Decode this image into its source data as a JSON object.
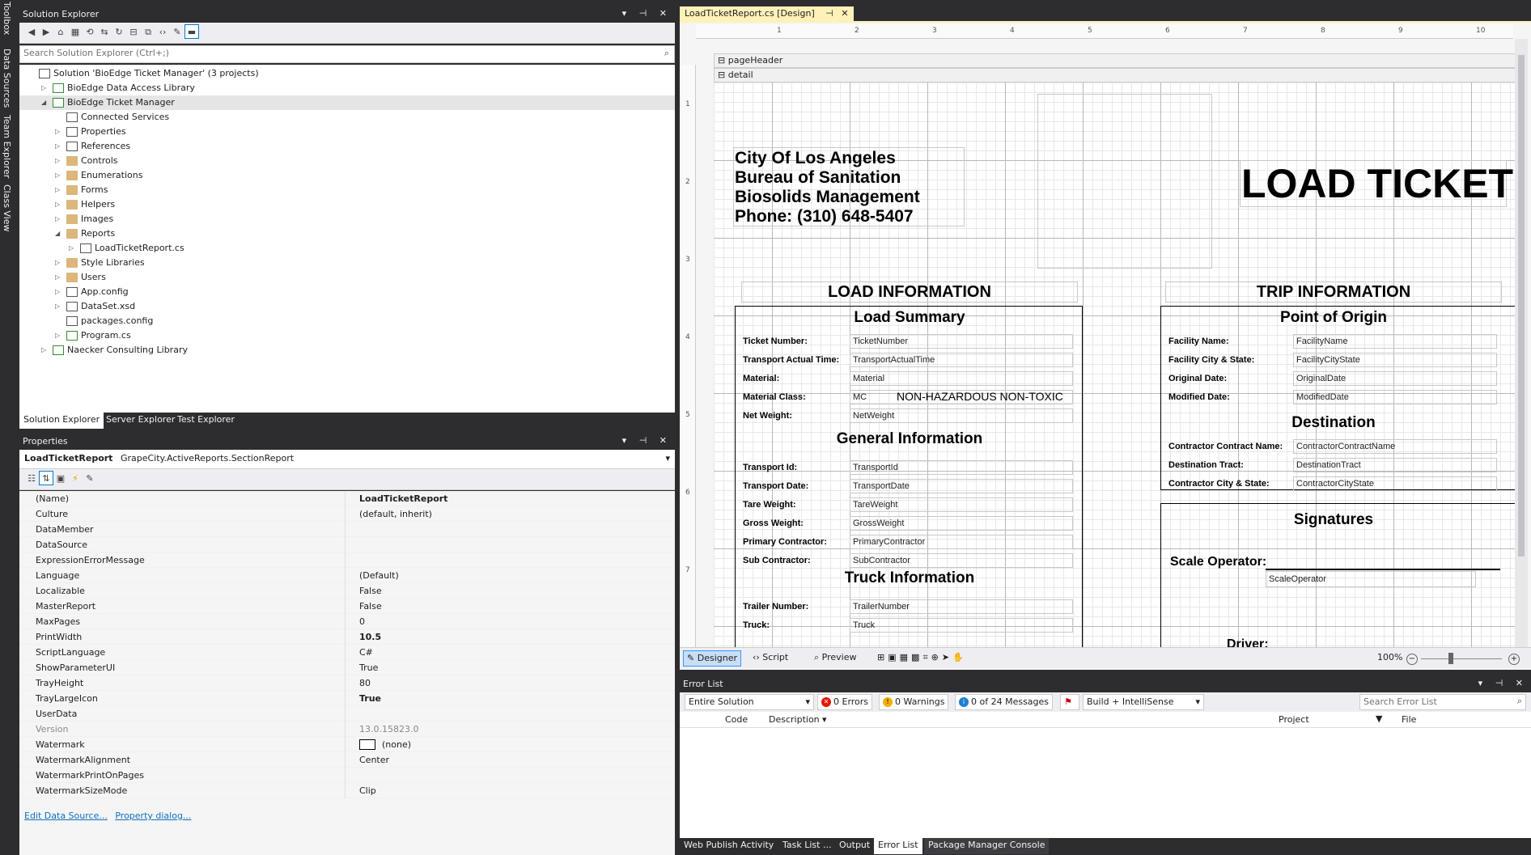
{
  "left_strip": {
    "tabs": [
      "Toolbox",
      "Data Sources",
      "Team Explorer",
      "Class View"
    ]
  },
  "solution_explorer": {
    "title": "Solution Explorer",
    "search_placeholder": "Search Solution Explorer (Ctrl+;)",
    "tree": [
      {
        "label": "Solution 'BioEdge Ticket Manager' (3 projects)",
        "level": 0,
        "icon": "solution-icon",
        "expander": ""
      },
      {
        "label": "BioEdge Data Access Library",
        "level": 1,
        "icon": "csharp-project-icon",
        "expander": "▷"
      },
      {
        "label": "BioEdge Ticket Manager",
        "level": 1,
        "icon": "csharp-project-icon",
        "expander": "◢"
      },
      {
        "label": "Connected Services",
        "level": 2,
        "icon": "connected-services-icon",
        "expander": ""
      },
      {
        "label": "Properties",
        "level": 2,
        "icon": "wrench-icon",
        "expander": "▷"
      },
      {
        "label": "References",
        "level": 2,
        "icon": "references-icon",
        "expander": "▷"
      },
      {
        "label": "Controls",
        "level": 2,
        "icon": "folder-icon",
        "expander": "▷"
      },
      {
        "label": "Enumerations",
        "level": 2,
        "icon": "folder-icon",
        "expander": "▷"
      },
      {
        "label": "Forms",
        "level": 2,
        "icon": "folder-icon",
        "expander": "▷"
      },
      {
        "label": "Helpers",
        "level": 2,
        "icon": "folder-icon",
        "expander": "▷"
      },
      {
        "label": "Images",
        "level": 2,
        "icon": "folder-icon",
        "expander": "▷"
      },
      {
        "label": "Reports",
        "level": 2,
        "icon": "folder-icon",
        "expander": "◢"
      },
      {
        "label": "LoadTicketReport.cs",
        "level": 3,
        "icon": "report-file-icon",
        "expander": "▷"
      },
      {
        "label": "Style Libraries",
        "level": 2,
        "icon": "folder-icon",
        "expander": "▷"
      },
      {
        "label": "Users",
        "level": 2,
        "icon": "folder-icon",
        "expander": "▷"
      },
      {
        "label": "App.config",
        "level": 2,
        "icon": "config-file-icon",
        "expander": "▷"
      },
      {
        "label": "DataSet.xsd",
        "level": 2,
        "icon": "dataset-icon",
        "expander": "▷"
      },
      {
        "label": "packages.config",
        "level": 2,
        "icon": "config-file-icon",
        "expander": ""
      },
      {
        "label": "Program.cs",
        "level": 2,
        "icon": "csharp-file-icon",
        "expander": "▷"
      },
      {
        "label": "Naecker Consulting Library",
        "level": 1,
        "icon": "csharp-project-icon",
        "expander": "▷"
      }
    ],
    "bottom_tabs": [
      "Solution Explorer",
      "Server Explorer",
      "Test Explorer"
    ]
  },
  "properties": {
    "title": "Properties",
    "object_name": "LoadTicketReport",
    "object_type": "GrapeCity.ActiveReports.SectionReport",
    "rows": [
      {
        "name": "(Name)",
        "value": "LoadTicketReport",
        "bold": true
      },
      {
        "name": "Culture",
        "value": "(default, inherit)"
      },
      {
        "name": "DataMember",
        "value": ""
      },
      {
        "name": "DataSource",
        "value": ""
      },
      {
        "name": "ExpressionErrorMessage",
        "value": ""
      },
      {
        "name": "Language",
        "value": "(Default)"
      },
      {
        "name": "Localizable",
        "value": "False"
      },
      {
        "name": "MasterReport",
        "value": "False"
      },
      {
        "name": "MaxPages",
        "value": "0"
      },
      {
        "name": "PrintWidth",
        "value": "10.5",
        "bold": true
      },
      {
        "name": "ScriptLanguage",
        "value": "C#"
      },
      {
        "name": "ShowParameterUI",
        "value": "True"
      },
      {
        "name": "TrayHeight",
        "value": "80"
      },
      {
        "name": "TrayLargeIcon",
        "value": "True",
        "bold": true
      },
      {
        "name": "UserData",
        "value": ""
      },
      {
        "name": "Version",
        "value": "13.0.15823.0",
        "gray": true
      },
      {
        "name": "Watermark",
        "value": "(none)",
        "swatch": true
      },
      {
        "name": "WatermarkAlignment",
        "value": "Center"
      },
      {
        "name": "WatermarkPrintOnPages",
        "value": ""
      },
      {
        "name": "WatermarkSizeMode",
        "value": "Clip"
      }
    ],
    "links": [
      "Edit Data Source...",
      "Property dialog..."
    ]
  },
  "designer": {
    "tab_title": "LoadTicketReport.cs [Design]",
    "ruler_numbers": [
      "1",
      "2",
      "3",
      "4",
      "5",
      "6",
      "7",
      "8",
      "9",
      "10"
    ],
    "vruler_numbers": [
      "1",
      "2",
      "3",
      "4",
      "5",
      "6",
      "7"
    ],
    "sections": [
      "pageHeader",
      "detail"
    ],
    "header_lines": [
      "City Of Los Angeles",
      "Bureau of Sanitation",
      "Biosolids Management",
      "Phone:  (310) 648-5407"
    ],
    "big_title": "LOAD TICKET",
    "load_info_title": "LOAD INFORMATION",
    "trip_info_title": "TRIP INFORMATION",
    "load_summary": {
      "title": "Load Summary",
      "rows": [
        {
          "label": "Ticket Number:",
          "field": "TicketNumber"
        },
        {
          "label": "Transport Actual Time:",
          "field": "TransportActualTime"
        },
        {
          "label": "Material:",
          "field": "Material"
        },
        {
          "label": "Material Class:",
          "field": "MC",
          "extra": "NON-HAZARDOUS NON-TOXIC"
        },
        {
          "label": "Net Weight:",
          "field": "NetWeight"
        }
      ]
    },
    "general_info": {
      "title": "General Information",
      "rows": [
        {
          "label": "Transport Id:",
          "field": "TransportId"
        },
        {
          "label": "Transport Date:",
          "field": "TransportDate"
        },
        {
          "label": "Tare Weight:",
          "field": "TareWeight"
        },
        {
          "label": "Gross Weight:",
          "field": "GrossWeight"
        },
        {
          "label": "Primary Contractor:",
          "field": "PrimaryContractor"
        },
        {
          "label": "Sub Contractor:",
          "field": "SubContractor"
        }
      ]
    },
    "truck_info": {
      "title": "Truck Information",
      "rows": [
        {
          "label": "Trailer Number:",
          "field": "TrailerNumber"
        },
        {
          "label": "Truck:",
          "field": "Truck"
        }
      ]
    },
    "point_of_origin": {
      "title": "Point of Origin",
      "rows": [
        {
          "label": "Facility Name:",
          "field": "FacilityName"
        },
        {
          "label": "Facility City & State:",
          "field": "FacilityCityState"
        },
        {
          "label": "Original Date:",
          "field": "OriginalDate"
        },
        {
          "label": "Modified Date:",
          "field": "ModifiedDate"
        }
      ]
    },
    "destination": {
      "title": "Destination",
      "rows": [
        {
          "label": "Contractor Contract Name:",
          "field": "ContractorContractName"
        },
        {
          "label": "Destination Tract:",
          "field": "DestinationTract"
        },
        {
          "label": "Contractor City & State:",
          "field": "ContractorCityState"
        }
      ]
    },
    "signatures": {
      "title": "Signatures",
      "scale_operator_label": "Scale Operator:",
      "scale_operator_field": "ScaleOperator",
      "driver_label": "Driver:"
    },
    "bottom_bar": {
      "designer": "Designer",
      "script": "Script",
      "preview": "Preview",
      "zoom": "100%"
    }
  },
  "error_list": {
    "title": "Error List",
    "scope": "Entire Solution",
    "errors": "0 Errors",
    "warnings": "0 Warnings",
    "messages": "0 of 24 Messages",
    "build_filter": "Build + IntelliSense",
    "search_placeholder": "Search Error List",
    "columns": [
      "Code",
      "Description",
      "Project",
      "File"
    ]
  },
  "bottom_tabs": [
    "Web Publish Activity",
    "Task List ...",
    "Output",
    "Error List",
    "Package Manager Console"
  ],
  "colors": {
    "chrome": "#2d2d30",
    "accent": "#007acc",
    "tab_active": "#fff1b8",
    "selection": "#cce8ff"
  }
}
